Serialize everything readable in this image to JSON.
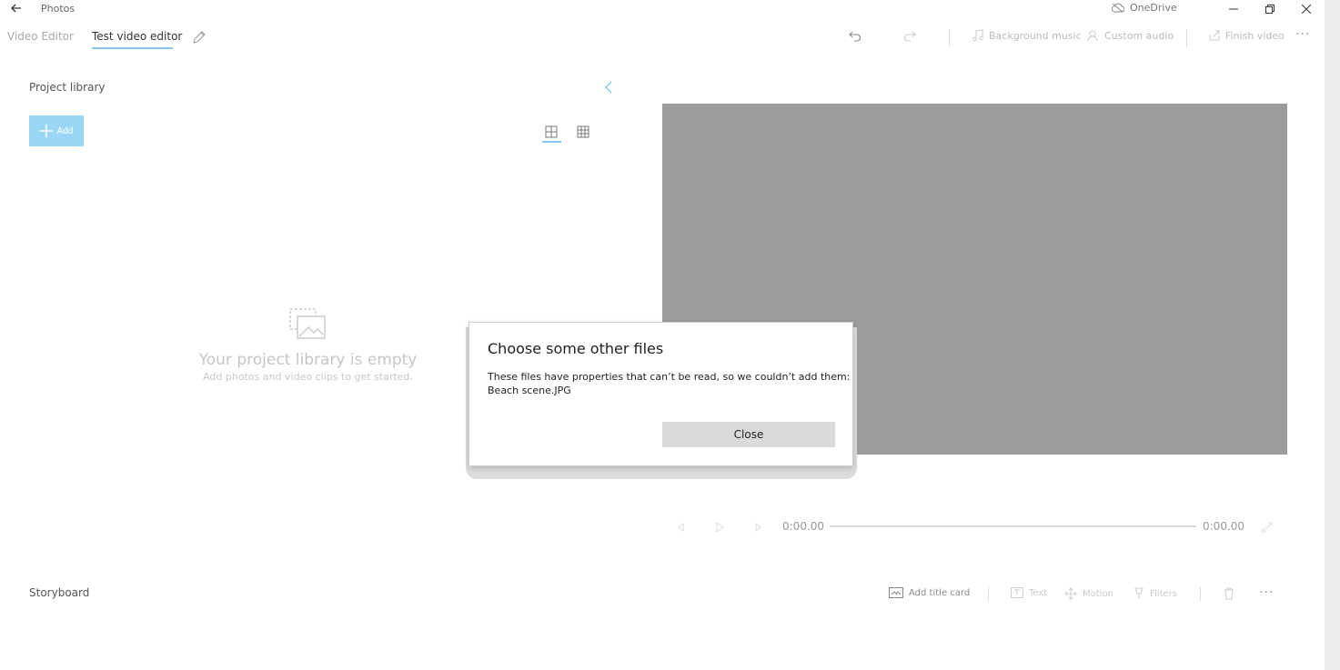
{
  "titlebar": {
    "app_title": "Photos",
    "onedrive_label": "OneDrive"
  },
  "tabs": {
    "video_editor": "Video Editor",
    "test_video_editor": "Test video editor"
  },
  "toolbar": {
    "background_music": "Background music",
    "custom_audio": "Custom audio",
    "finish_video": "Finish video",
    "more": "···"
  },
  "library": {
    "title": "Project library",
    "add_label": "Add",
    "empty_title": "Your project library is empty",
    "empty_subtitle": "Add photos and video clips to get started."
  },
  "playback": {
    "current_time": "0:00.00",
    "total_time": "0:00.00"
  },
  "storyboard": {
    "title": "Storyboard",
    "add_title_card": "Add title card",
    "text": "Text",
    "motion": "Motion",
    "filters": "Filters",
    "more": "···"
  },
  "dialog": {
    "title": "Choose some other files",
    "message": "These files have properties that can’t be read, so we couldn’t add them:",
    "file": "Beach scene.JPG",
    "close_label": "Close"
  },
  "colors": {
    "accent": "#85c8ee",
    "add_button": "#9ad7f6",
    "preview": "#9c9d9a"
  },
  "icons": [
    "back-arrow-icon",
    "cloud-icon",
    "minimize-icon",
    "maximize-icon",
    "close-icon",
    "pencil-icon",
    "undo-icon",
    "redo-icon",
    "music-note-icon",
    "custom-audio-icon",
    "export-icon",
    "chevron-left-icon",
    "plus-icon",
    "large-grid-icon",
    "small-grid-icon",
    "empty-library-icon",
    "previous-frame-icon",
    "play-icon",
    "next-frame-icon",
    "fullscreen-icon",
    "title-card-icon",
    "text-icon",
    "motion-icon",
    "filters-icon",
    "trash-icon"
  ]
}
